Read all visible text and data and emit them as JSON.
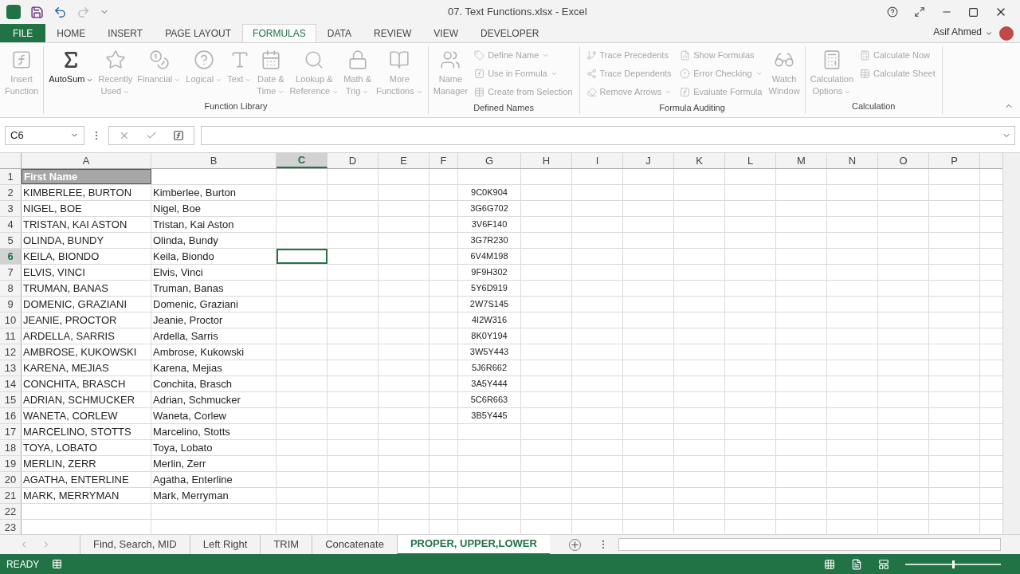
{
  "window": {
    "title": "07. Text Functions.xlsx - Excel",
    "user": "Asif Ahmed"
  },
  "ribbon_tabs": [
    {
      "label": "FILE",
      "kind": "file"
    },
    {
      "label": "HOME",
      "kind": "tab",
      "selected": false
    },
    {
      "label": "INSERT",
      "kind": "tab",
      "selected": false
    },
    {
      "label": "PAGE LAYOUT",
      "kind": "tab",
      "selected": false
    },
    {
      "label": "FORMULAS",
      "kind": "tab",
      "selected": true
    },
    {
      "label": "DATA",
      "kind": "tab",
      "selected": false
    },
    {
      "label": "REVIEW",
      "kind": "tab",
      "selected": false
    },
    {
      "label": "VIEW",
      "kind": "tab",
      "selected": false
    },
    {
      "label": "DEVELOPER",
      "kind": "tab",
      "selected": false
    }
  ],
  "ribbon_groups": [
    {
      "items": [
        {
          "kind": "large",
          "lines": [
            "Insert",
            "Function"
          ],
          "disabled": true,
          "dropdown": false
        }
      ]
    },
    {
      "title": "Function Library",
      "items": [
        {
          "kind": "large",
          "lines": [
            "AutoSum"
          ],
          "disabled": false,
          "dropdown": true
        },
        {
          "kind": "large",
          "lines": [
            "Recently",
            "Used"
          ],
          "disabled": true,
          "dropdown": true
        },
        {
          "kind": "large",
          "lines": [
            "Financial"
          ],
          "disabled": true,
          "dropdown": true
        },
        {
          "kind": "large",
          "lines": [
            "Logical"
          ],
          "disabled": true,
          "dropdown": true
        },
        {
          "kind": "large",
          "lines": [
            "Text"
          ],
          "disabled": true,
          "dropdown": true
        },
        {
          "kind": "large",
          "lines": [
            "Date &",
            "Time"
          ],
          "disabled": true,
          "dropdown": true
        },
        {
          "kind": "large",
          "lines": [
            "Lookup &",
            "Reference"
          ],
          "disabled": true,
          "dropdown": true
        },
        {
          "kind": "large",
          "lines": [
            "Math &",
            "Trig"
          ],
          "disabled": true,
          "dropdown": true
        },
        {
          "kind": "large",
          "lines": [
            "More",
            "Functions"
          ],
          "disabled": true,
          "dropdown": true
        }
      ]
    },
    {
      "title": "Defined Names",
      "items": [
        {
          "kind": "large",
          "lines": [
            "Name",
            "Manager"
          ],
          "disabled": true,
          "dropdown": false
        },
        {
          "kind": "small",
          "lines": [
            "Define Name"
          ],
          "disabled": true,
          "dropdown": true
        },
        {
          "kind": "small",
          "lines": [
            "Use in Formula"
          ],
          "disabled": true,
          "dropdown": true
        },
        {
          "kind": "small",
          "lines": [
            "Create from Selection"
          ],
          "disabled": true,
          "dropdown": false
        }
      ]
    },
    {
      "title": "Formula Auditing",
      "items": [
        {
          "kind": "small",
          "lines": [
            "Trace Precedents"
          ],
          "disabled": true,
          "dropdown": false
        },
        {
          "kind": "small",
          "lines": [
            "Trace Dependents"
          ],
          "disabled": true,
          "dropdown": false
        },
        {
          "kind": "small",
          "lines": [
            "Remove Arrows"
          ],
          "disabled": true,
          "dropdown": true
        },
        {
          "kind": "small",
          "lines": [
            "Show Formulas"
          ],
          "disabled": true,
          "dropdown": false
        },
        {
          "kind": "small",
          "lines": [
            "Error Checking"
          ],
          "disabled": true,
          "dropdown": true
        },
        {
          "kind": "small",
          "lines": [
            "Evaluate Formula"
          ],
          "disabled": true,
          "dropdown": false
        },
        {
          "kind": "large",
          "lines": [
            "Watch",
            "Window"
          ],
          "disabled": true,
          "dropdown": false
        }
      ]
    },
    {
      "title": "Calculation",
      "items": [
        {
          "kind": "large",
          "lines": [
            "Calculation",
            "Options"
          ],
          "disabled": true,
          "dropdown": true
        },
        {
          "kind": "small",
          "lines": [
            "Calculate Now"
          ],
          "disabled": true,
          "dropdown": false
        },
        {
          "kind": "small",
          "lines": [
            "Calculate Sheet"
          ],
          "disabled": true,
          "dropdown": false
        }
      ]
    }
  ],
  "name_box": "C6",
  "columns": [
    {
      "label": "A",
      "selected": false
    },
    {
      "label": "B",
      "selected": false
    },
    {
      "label": "C",
      "selected": true
    },
    {
      "label": "D",
      "selected": false
    },
    {
      "label": "E",
      "selected": false
    },
    {
      "label": "F",
      "selected": false
    },
    {
      "label": "G",
      "selected": false
    },
    {
      "label": "H",
      "selected": false
    },
    {
      "label": "I",
      "selected": false
    },
    {
      "label": "J",
      "selected": false
    },
    {
      "label": "K",
      "selected": false
    },
    {
      "label": "L",
      "selected": false
    },
    {
      "label": "M",
      "selected": false
    },
    {
      "label": "N",
      "selected": false
    },
    {
      "label": "O",
      "selected": false
    },
    {
      "label": "P",
      "selected": false
    }
  ],
  "rows": [
    {
      "number": "1",
      "kind": "header",
      "selected": false,
      "cells": [
        "First Name",
        "",
        ""
      ]
    },
    {
      "number": "2",
      "kind": "data",
      "selected": false,
      "cells": [
        "KIMBERLEE, BURTON",
        "Kimberlee, Burton",
        "9C0K904"
      ]
    },
    {
      "number": "3",
      "kind": "data",
      "selected": false,
      "cells": [
        "NIGEL, BOE",
        "Nigel, Boe",
        "3G6G702"
      ]
    },
    {
      "number": "4",
      "kind": "data",
      "selected": false,
      "cells": [
        "TRISTAN, KAI ASTON",
        "Tristan, Kai Aston",
        "3V6F140"
      ]
    },
    {
      "number": "5",
      "kind": "data",
      "selected": false,
      "cells": [
        "OLINDA, BUNDY",
        "Olinda, Bundy",
        "3G7R230"
      ]
    },
    {
      "number": "6",
      "kind": "data",
      "selected": true,
      "cells": [
        "KEILA, BIONDO",
        "Keila, Biondo",
        "6V4M198"
      ]
    },
    {
      "number": "7",
      "kind": "data",
      "selected": false,
      "cells": [
        "ELVIS, VINCI",
        "Elvis, Vinci",
        "9F9H302"
      ]
    },
    {
      "number": "8",
      "kind": "data",
      "selected": false,
      "cells": [
        "TRUMAN, BANAS",
        "Truman, Banas",
        "5Y6D919"
      ]
    },
    {
      "number": "9",
      "kind": "data",
      "selected": false,
      "cells": [
        "DOMENIC, GRAZIANI",
        "Domenic, Graziani",
        "2W7S145"
      ]
    },
    {
      "number": "10",
      "kind": "data",
      "selected": false,
      "cells": [
        "JEANIE, PROCTOR",
        "Jeanie, Proctor",
        "4I2W316"
      ]
    },
    {
      "number": "11",
      "kind": "data",
      "selected": false,
      "cells": [
        "ARDELLA, SARRIS",
        "Ardella, Sarris",
        "8K0Y194"
      ]
    },
    {
      "number": "12",
      "kind": "data",
      "selected": false,
      "cells": [
        "AMBROSE, KUKOWSKI",
        "Ambrose, Kukowski",
        "3W5Y443"
      ]
    },
    {
      "number": "13",
      "kind": "data",
      "selected": false,
      "cells": [
        "KARENA, MEJIAS",
        "Karena, Mejias",
        "5J6R662"
      ]
    },
    {
      "number": "14",
      "kind": "data",
      "selected": false,
      "cells": [
        "CONCHITA, BRASCH",
        "Conchita, Brasch",
        "3A5Y444"
      ]
    },
    {
      "number": "15",
      "kind": "data",
      "selected": false,
      "cells": [
        "ADRIAN, SCHMUCKER",
        "Adrian, Schmucker",
        "5C6R663"
      ]
    },
    {
      "number": "16",
      "kind": "data",
      "selected": false,
      "cells": [
        "WANETA, CORLEW",
        "Waneta, Corlew",
        "3B5Y445"
      ]
    },
    {
      "number": "17",
      "kind": "data",
      "selected": false,
      "cells": [
        "MARCELINO, STOTTS",
        "Marcelino, Stotts",
        ""
      ]
    },
    {
      "number": "18",
      "kind": "data",
      "selected": false,
      "cells": [
        "TOYA, LOBATO",
        "Toya, Lobato",
        ""
      ]
    },
    {
      "number": "19",
      "kind": "data",
      "selected": false,
      "cells": [
        "MERLIN, ZERR",
        "Merlin, Zerr",
        ""
      ]
    },
    {
      "number": "20",
      "kind": "data",
      "selected": false,
      "cells": [
        "AGATHA, ENTERLINE",
        "Agatha, Enterline",
        ""
      ]
    },
    {
      "number": "21",
      "kind": "data",
      "selected": false,
      "cells": [
        "MARK, MERRYMAN",
        "Mark, Merryman",
        ""
      ]
    },
    {
      "number": "22",
      "kind": "data",
      "selected": false,
      "cells": [
        "",
        "",
        ""
      ]
    },
    {
      "number": "23",
      "kind": "data",
      "selected": false,
      "cells": [
        "",
        "",
        ""
      ]
    }
  ],
  "sheet_tabs": [
    {
      "label": "Find, Search, MID",
      "selected": false
    },
    {
      "label": "Left Right",
      "selected": false
    },
    {
      "label": "TRIM",
      "selected": false
    },
    {
      "label": "Concatenate",
      "selected": false
    },
    {
      "label": "PROPER, UPPER,LOWER",
      "selected": true
    }
  ],
  "status_bar": {
    "mode": "READY",
    "zoom": {
      "level": 0.5
    }
  }
}
